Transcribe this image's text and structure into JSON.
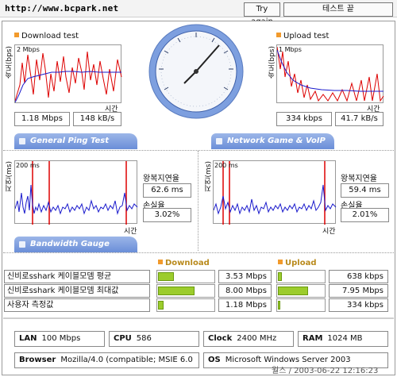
{
  "topbar": {
    "url": "http://www.bcpark.net",
    "try_again": "Try again",
    "test_end": "테스트 끝"
  },
  "download": {
    "title": "Download test",
    "axis_y": "속도(bps)",
    "scale": "2 Mbps",
    "axis_x": "시간",
    "mbps": "1.18 Mbps",
    "kbs": "148 kB/s"
  },
  "upload": {
    "title": "Upload test",
    "axis_y": "속도(bps)",
    "scale": "1 Mbps",
    "axis_x": "시간",
    "kbps": "334 kbps",
    "kbs": "41.7 kB/s"
  },
  "tabs": {
    "ping": "General Ping Test",
    "game": "Network Game & VoIP Test",
    "bandwidth": "Bandwidth Gauge"
  },
  "ping_left": {
    "axis_y": "지연(ms)",
    "scale": "200 ms",
    "axis_x": "시간",
    "rtt_label": "왕복지연율",
    "rtt_value": "62.6 ms",
    "loss_label": "손실율",
    "loss_value": "3.02%"
  },
  "ping_right": {
    "axis_y": "지연(ms)",
    "scale": "200 ms",
    "axis_x": "시간",
    "rtt_label": "왕복지연율",
    "rtt_value": "59.4 ms",
    "loss_label": "손실율",
    "loss_value": "2.01%"
  },
  "bandwidth": {
    "download_header": "Download",
    "upload_header": "Upload",
    "rows": [
      {
        "label": "신비로sshark 케이블모뎀 평균",
        "download": "3.53 Mbps",
        "download_fill": 0.29,
        "upload": "638 kbps",
        "upload_fill": 0.08
      },
      {
        "label": "신비로sshark 케이블모뎀 최대값",
        "download": "8.00 Mbps",
        "download_fill": 0.66,
        "upload": "7.95 Mbps",
        "upload_fill": 0.66
      },
      {
        "label": "사용자 측정값",
        "download": "1.18 Mbps",
        "download_fill": 0.1,
        "upload": "334 kbps",
        "upload_fill": 0.05
      }
    ]
  },
  "system": {
    "lan_label": "LAN",
    "lan_value": "100 Mbps",
    "cpu_label": "CPU",
    "cpu_value": "586",
    "clock_label": "Clock",
    "clock_value": "2400 MHz",
    "ram_label": "RAM",
    "ram_value": "1024 MB",
    "browser_label": "Browser",
    "browser_value": "Mozilla/4.0 (compatible; MSIE 6.0",
    "os_label": "OS",
    "os_value": "Microsoft Windows Server 2003"
  },
  "watermark": "월스 / 2003-06-22 12:16:23",
  "colors": {
    "series_blue": "#1a1acc",
    "series_red": "#dd0000",
    "tab_blue": "#7b9be0",
    "gauge_green": "#9ccc2c",
    "accent_orange": "#f29a2c"
  }
}
